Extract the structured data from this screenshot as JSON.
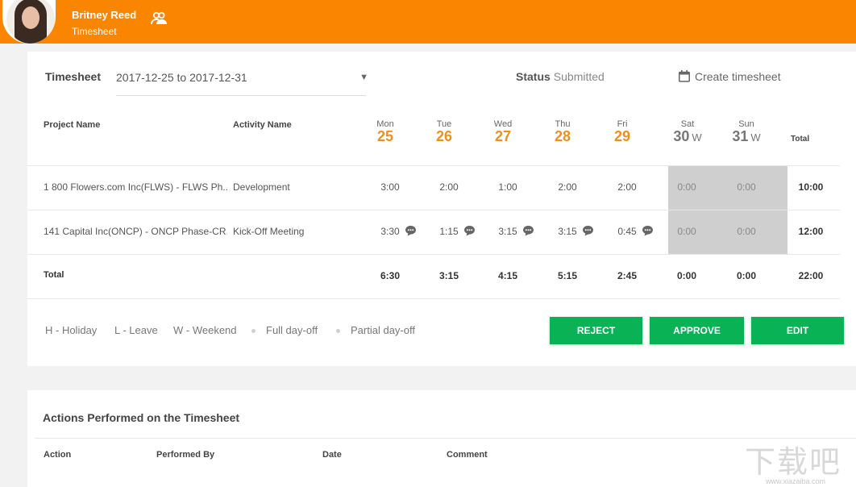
{
  "header": {
    "user_name": "Britney Reed",
    "subtitle": "Timesheet",
    "accent_color": "#fa8500",
    "icons": [
      "avatar",
      "switch-user-icon"
    ]
  },
  "filters": {
    "timesheet_label": "Timesheet",
    "period_value": "2017-12-25 to 2017-12-31",
    "status_label": "Status",
    "status_value": "Submitted",
    "create_label": "Create timesheet"
  },
  "table": {
    "col_project": "Project Name",
    "col_activity": "Activity Name",
    "col_total": "Total",
    "days": [
      {
        "name": "Mon",
        "date": "25",
        "flag": ""
      },
      {
        "name": "Tue",
        "date": "26",
        "flag": ""
      },
      {
        "name": "Wed",
        "date": "27",
        "flag": ""
      },
      {
        "name": "Thu",
        "date": "28",
        "flag": ""
      },
      {
        "name": "Fri",
        "date": "29",
        "flag": ""
      },
      {
        "name": "Sat",
        "date": "30",
        "flag": "W"
      },
      {
        "name": "Sun",
        "date": "31",
        "flag": "W"
      }
    ],
    "rows": [
      {
        "project": "1 800 Flowers.com Inc(FLWS) - FLWS Ph...",
        "activity": "Development",
        "hours": [
          "3:00",
          "2:00",
          "1:00",
          "2:00",
          "2:00",
          "0:00",
          "0:00"
        ],
        "total": "10:00"
      },
      {
        "project": "141 Capital Inc(ONCP) - ONCP Phase-CR...",
        "activity": "Kick-Off Meeting",
        "hours": [
          "3:30",
          "1:15",
          "3:15",
          "3:15",
          "0:45",
          "0:00",
          "0:00"
        ],
        "total": "12:00"
      }
    ],
    "totals": {
      "label": "Total",
      "hours": [
        "6:30",
        "3:15",
        "4:15",
        "5:15",
        "2:45",
        "0:00",
        "0:00"
      ],
      "total": "22:00"
    }
  },
  "legend": {
    "holiday": "H - Holiday",
    "leave": "L - Leave",
    "weekend": "W - Weekend",
    "full_day_off": "Full day-off",
    "partial_day_off": "Partial day-off"
  },
  "buttons": {
    "reject": "REJECT",
    "approve": "APPROVE",
    "edit": "EDIT",
    "color": "#09b254"
  },
  "actions": {
    "title": "Actions Performed on the Timesheet",
    "columns": [
      "Action",
      "Performed By",
      "Date",
      "Comment"
    ]
  },
  "watermark": {
    "glyphs": "下载吧",
    "sub": "www.xiazaiba.com"
  }
}
